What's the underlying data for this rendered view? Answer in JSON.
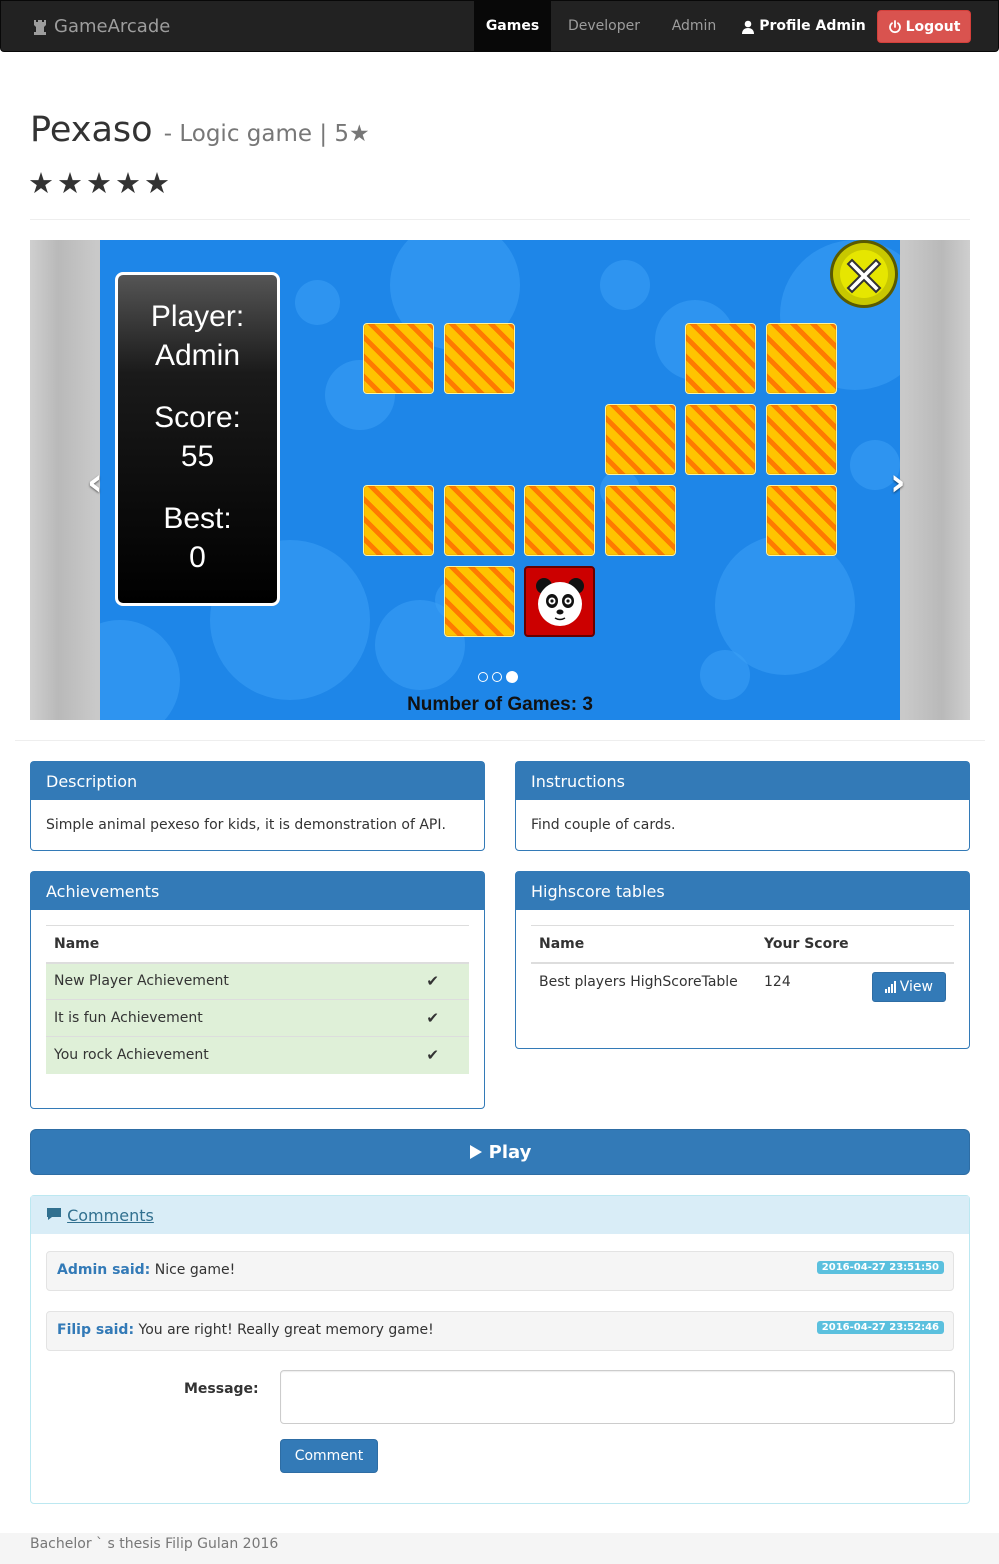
{
  "navbar": {
    "brand": "GameArcade",
    "items": [
      {
        "label": "Games",
        "active": true
      },
      {
        "label": "Developer",
        "active": false
      },
      {
        "label": "Admin",
        "active": false
      }
    ],
    "profile_label": "Profile Admin",
    "logout_label": "Logout"
  },
  "game": {
    "title": "Pexaso",
    "subtitle": "- Logic game | 5★",
    "rating_stars": "★★★★★",
    "rating": 5
  },
  "carousel": {
    "player_label": "Player:",
    "player_value": "Admin",
    "score_label": "Score:",
    "score_value": "55",
    "best_label": "Best:",
    "best_value": "0",
    "caption": "Number of Games: 3",
    "slide_count": 3,
    "active_slide": 3,
    "prev_icon": "chevron-left-icon",
    "next_icon": "chevron-right-icon"
  },
  "description": {
    "title": "Description",
    "text": "Simple animal pexeso for kids, it is demonstration of API."
  },
  "instructions": {
    "title": "Instructions",
    "text": "Find couple of cards."
  },
  "achievements": {
    "title": "Achievements",
    "header_name": "Name",
    "rows": [
      {
        "name": "New Player Achievement",
        "mark": "✔"
      },
      {
        "name": "It is fun Achievement",
        "mark": "✔"
      },
      {
        "name": "You rock Achievement",
        "mark": "✔"
      }
    ]
  },
  "highscores": {
    "title": "Highscore tables",
    "header_name": "Name",
    "header_score": "Your Score",
    "rows": [
      {
        "name": "Best players HighScoreTable",
        "score": "124",
        "button": "View"
      }
    ]
  },
  "play_label": "Play",
  "comments": {
    "title": "Comments",
    "items": [
      {
        "author": "Admin said:",
        "text": " Nice game!",
        "timestamp": "2016-04-27 23:51:50"
      },
      {
        "author": "Filip said:",
        "text": " You are right! Really great memory game!",
        "timestamp": "2016-04-27 23:52:46"
      }
    ],
    "message_label": "Message:",
    "message_value": "",
    "submit_label": "Comment"
  },
  "footer": "Bachelor ` s thesis Filip Gulan 2016",
  "colors": {
    "primary": "#337ab7",
    "danger": "#d9534f",
    "navbar": "#222222",
    "info_label": "#5bc0de",
    "success_row": "#dff0d8",
    "game_bg": "#1e86e8"
  }
}
